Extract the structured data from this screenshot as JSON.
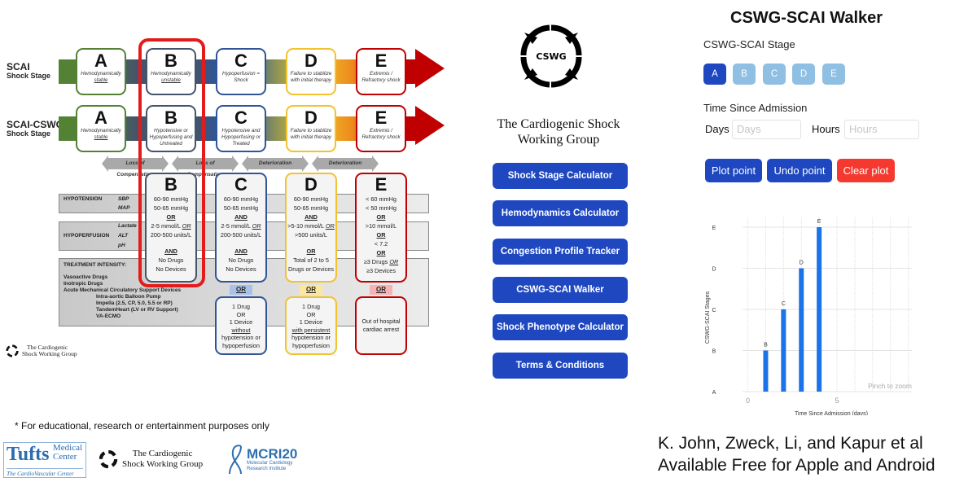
{
  "infographic": {
    "rows": [
      {
        "label_line1": "SCAI",
        "label_line2": "Shock Stage"
      },
      {
        "label_line1": "SCAI-CSWG",
        "label_line2": "Shock Stage"
      }
    ],
    "scai_stages": [
      {
        "letter": "A",
        "desc": [
          "Hemodynamically",
          "stable"
        ],
        "underline_index": 1,
        "color": "#548235"
      },
      {
        "letter": "B",
        "desc": [
          "Hemodynamically",
          "unstable"
        ],
        "underline_index": 1,
        "color": "#44546a"
      },
      {
        "letter": "C",
        "desc": [
          "Hypoperfusion =",
          "Shock"
        ],
        "underline_index": -1,
        "color": "#2f5597"
      },
      {
        "letter": "D",
        "desc": [
          "Failure to stabilize",
          "with initial therapy"
        ],
        "underline_index": -1,
        "color": "#f2c230"
      },
      {
        "letter": "E",
        "desc": [
          "Extremis /",
          "Refractory shock"
        ],
        "underline_index": -1,
        "color": "#c00000"
      }
    ],
    "cswg_stages": [
      {
        "letter": "A",
        "desc": [
          "Hemodynamically",
          "stable"
        ],
        "underline_index": 1
      },
      {
        "letter": "B",
        "desc": [
          "Hypotensive or",
          "Hypoperfusing and",
          "Untreated"
        ],
        "underline_index": -1
      },
      {
        "letter": "C",
        "desc": [
          "Hypotensive and",
          "Hypoperfusing or",
          "Treated"
        ],
        "underline_index": -1
      },
      {
        "letter": "D",
        "desc": [
          "Failure to stabilize",
          "with initial therapy"
        ],
        "underline_index": -1
      },
      {
        "letter": "E",
        "desc": [
          "Extremis /",
          "Refractory shock"
        ],
        "underline_index": -1
      }
    ],
    "transitions": [
      "Loss of Compensation",
      "Loss of Compensation",
      "Deterioration",
      "Deterioration"
    ],
    "criteria_labels": {
      "hypotension": "HYPOTENSION",
      "sbp": "SBP",
      "map": "MAP",
      "hypoperfusion": "HYPOPERFUSION",
      "lactate": "Lactate",
      "alt": "ALT",
      "ph": "pH",
      "treatment_intensity": "TREATMENT INTENSITY:",
      "treatments": [
        "Vasoactive Drugs",
        "Inotropic Drugs",
        "Acute Mechanical Circulatory Support Devices",
        "Intra-aortic Balloon Pump",
        "Impella (2.5, CP, 5.0, 5.5 or RP)",
        "TandemHeart (LV or RV Support)",
        "VA-ECMO"
      ]
    },
    "criteria": [
      {
        "letter": "B",
        "sbp": "60-90 mmHg",
        "map": "50-65 mmHg",
        "join1": "OR",
        "lactate": "2-5 mmol/L",
        "lactate_or": "OR",
        "alt": "200-500 units/L",
        "ph": "",
        "join2": "AND",
        "treat1": "No Drugs",
        "treat2": "No Devices"
      },
      {
        "letter": "C",
        "sbp": "60-90 mmHg",
        "map": "50-65 mmHg",
        "join1": "AND",
        "lactate": "2-5 mmol/L",
        "lactate_or": "OR",
        "alt": "200-500 units/L",
        "ph": "",
        "join2": "AND",
        "treat1": "No Drugs",
        "treat2": "No Devices",
        "or_tab": "OR",
        "alt_box": [
          "1 Drug",
          "OR",
          "1 Device",
          "without",
          "hypotension or",
          "hypoperfusion"
        ]
      },
      {
        "letter": "D",
        "sbp": "60-90 mmHg",
        "map": "50-65 mmHg",
        "join1": "AND",
        "lactate": ">5-10 mmol/L",
        "lactate_or": "OR",
        "alt": ">500 units/L",
        "ph": "",
        "join2": "OR",
        "treat1": "Total of 2 to 5",
        "treat2": "Drugs or Devices",
        "or_tab": "OR",
        "alt_box": [
          "1 Drug",
          "OR",
          "1 Device",
          "with persistent",
          "hypotension or",
          "hypoperfusion"
        ]
      },
      {
        "letter": "E",
        "sbp": "< 60 mmHg",
        "map": "< 50 mmHg",
        "join1": "OR",
        "lactate": ">10 mmol/L",
        "lactate_or": "",
        "alt": "OR",
        "ph": "< 7.2",
        "join2": "OR",
        "treat1": "≥3 Drugs",
        "treat1_or": "OR",
        "treat2": "≥3 Devices",
        "or_tab": "OR",
        "alt_box": [
          "Out of hospital",
          "cardiac arrest"
        ]
      }
    ],
    "org_logo_text": [
      "The Cardiogenic",
      "Shock Working Group"
    ]
  },
  "footer": {
    "disclaimer": "* For educational, research or entertainment purposes only",
    "tufts": {
      "big": "Tufts",
      "line1": "Medical",
      "line2": "Center",
      "sub": "The CardioVascular Center"
    },
    "cswg": [
      "The Cardiogenic",
      "Shock Working Group"
    ],
    "mcri": {
      "big": "MCRI20",
      "line1": "Molecular Cardiology",
      "line2": "Research Institute"
    }
  },
  "app_home": {
    "logo_text": "CSWG",
    "org_title": [
      "The Cardiogenic Shock",
      "Working Group"
    ],
    "nav": [
      "Shock Stage Calculator",
      "Hemodynamics Calculator",
      "Congestion Profile Tracker",
      "CSWG-SCAI Walker",
      "Shock Phenotype Calculator",
      "Terms & Conditions"
    ],
    "accent": "#1f48c0"
  },
  "walker": {
    "title": "CSWG-SCAI Walker",
    "stage_label": "CSWG-SCAI Stage",
    "stages": [
      "A",
      "B",
      "C",
      "D",
      "E"
    ],
    "selected_stage": "A",
    "time_label": "Time Since Admission",
    "days_label": "Days",
    "days_placeholder": "Days",
    "days_value": "",
    "hours_label": "Hours",
    "hours_placeholder": "Hours",
    "hours_value": "",
    "buttons": {
      "plot": "Plot point",
      "undo": "Undo point",
      "clear": "Clear plot"
    },
    "colors": {
      "selected": "#1f48c0",
      "unselected": "#8fbfe3",
      "danger": "#f5392e",
      "bar": "#1a73e8"
    }
  },
  "chart_data": {
    "type": "bar",
    "title": "",
    "xlabel": "Time Since Admission (days)",
    "ylabel": "CSWG-SCAI Stages",
    "y_categories": [
      "A",
      "B",
      "C",
      "D",
      "E"
    ],
    "x_ticks": [
      0,
      5
    ],
    "xlim": [
      -0.3,
      9.2
    ],
    "points": [
      {
        "x": 1,
        "stage": "B",
        "label": "B"
      },
      {
        "x": 2,
        "stage": "C",
        "label": "C"
      },
      {
        "x": 3,
        "stage": "D",
        "label": "D"
      },
      {
        "x": 4,
        "stage": "E",
        "label": "E"
      }
    ],
    "grid": true,
    "annotation": "Pinch to zoom"
  },
  "credits": [
    "K. John, Zweck, Li, and Kapur et al",
    "Available Free for Apple and Android"
  ]
}
